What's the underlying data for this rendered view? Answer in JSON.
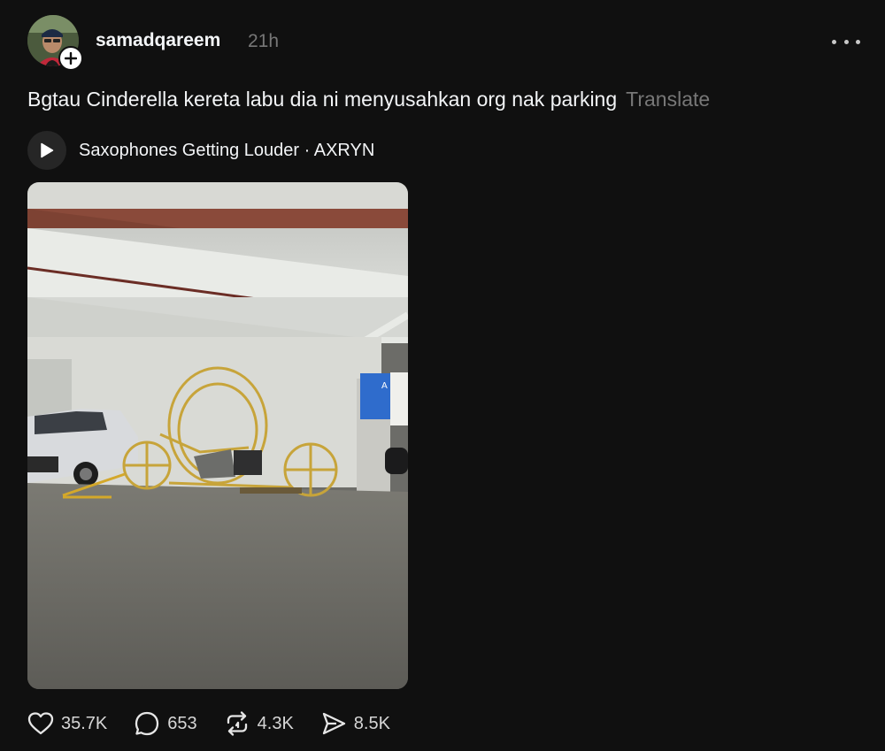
{
  "post": {
    "username": "samadqareem",
    "timestamp": "21h",
    "caption": "Bgtau Cinderella kereta labu dia ni menyusahkan org nak parking",
    "translate_label": "Translate",
    "music": {
      "label": "Saxophones Getting Louder · AXRYN",
      "icon": "play-icon"
    },
    "photo_icon": "photo-carriage-in-parking-lot"
  },
  "actions": {
    "likes": "35.7K",
    "replies": "653",
    "reposts": "4.3K",
    "shares": "8.5K"
  },
  "icons": {
    "more": "more-options-icon",
    "follow": "plus-icon",
    "like": "heart-icon",
    "reply": "comment-bubble-icon",
    "repost": "repost-icon",
    "share": "send-icon"
  },
  "colors": {
    "background": "#101010",
    "text": "#f3f5f7",
    "muted": "#777777"
  }
}
